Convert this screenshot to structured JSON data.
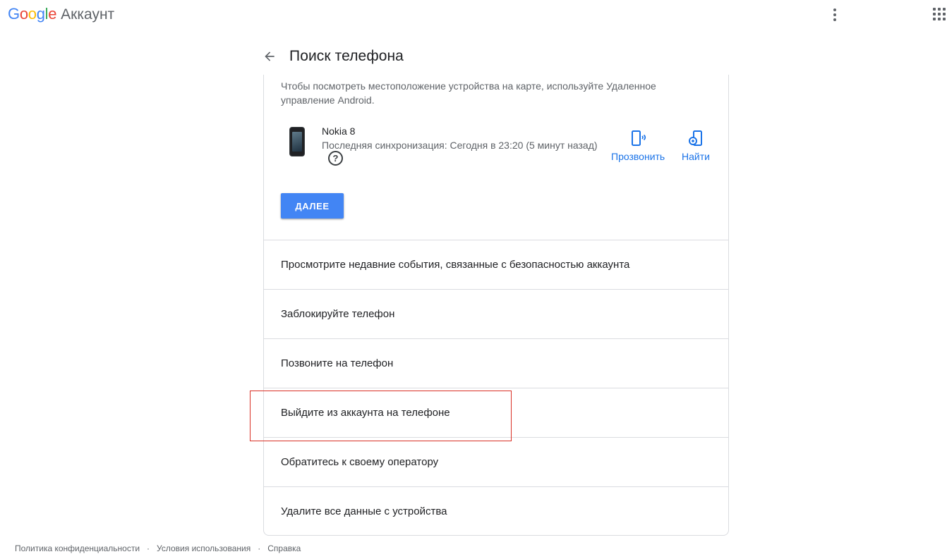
{
  "topbar": {
    "logo_letters": [
      {
        "ch": "G",
        "color": "#4285f4"
      },
      {
        "ch": "o",
        "color": "#ea4335"
      },
      {
        "ch": "o",
        "color": "#fbbc05"
      },
      {
        "ch": "g",
        "color": "#4285f4"
      },
      {
        "ch": "l",
        "color": "#34a853"
      },
      {
        "ch": "e",
        "color": "#ea4335"
      }
    ],
    "product": "Аккаунт",
    "menu_icon": "more-vert-icon",
    "apps_icon": "apps-grid-icon"
  },
  "header": {
    "back_icon": "arrow-back-icon",
    "title": "Поиск телефона"
  },
  "card": {
    "description": "Чтобы посмотреть местоположение устройства на карте, используйте Удаленное управление Android.",
    "device": {
      "name": "Nokia 8",
      "last_sync": "Последняя синхронизация: Сегодня в 23:20 (5 минут назад)",
      "help_glyph": "?"
    },
    "actions": {
      "ring_label": "Прозвонить",
      "find_label": "Найти"
    },
    "next_button": "ДАЛЕЕ",
    "menu_items": [
      "Просмотрите недавние события, связанные с безопасностью аккаунта",
      "Заблокируйте телефон",
      "Позвоните на телефон",
      "Выйдите из аккаунта на телефоне",
      "Обратитесь к своему оператору",
      "Удалите все данные с устройства"
    ]
  },
  "footer": {
    "privacy": "Политика конфиденциальности",
    "terms": "Условия использования",
    "help": "Справка",
    "separator": "·"
  },
  "colors": {
    "accent": "#1a73e8",
    "button": "#4285f4",
    "highlight": "#d93025",
    "divider": "#dadce0"
  }
}
